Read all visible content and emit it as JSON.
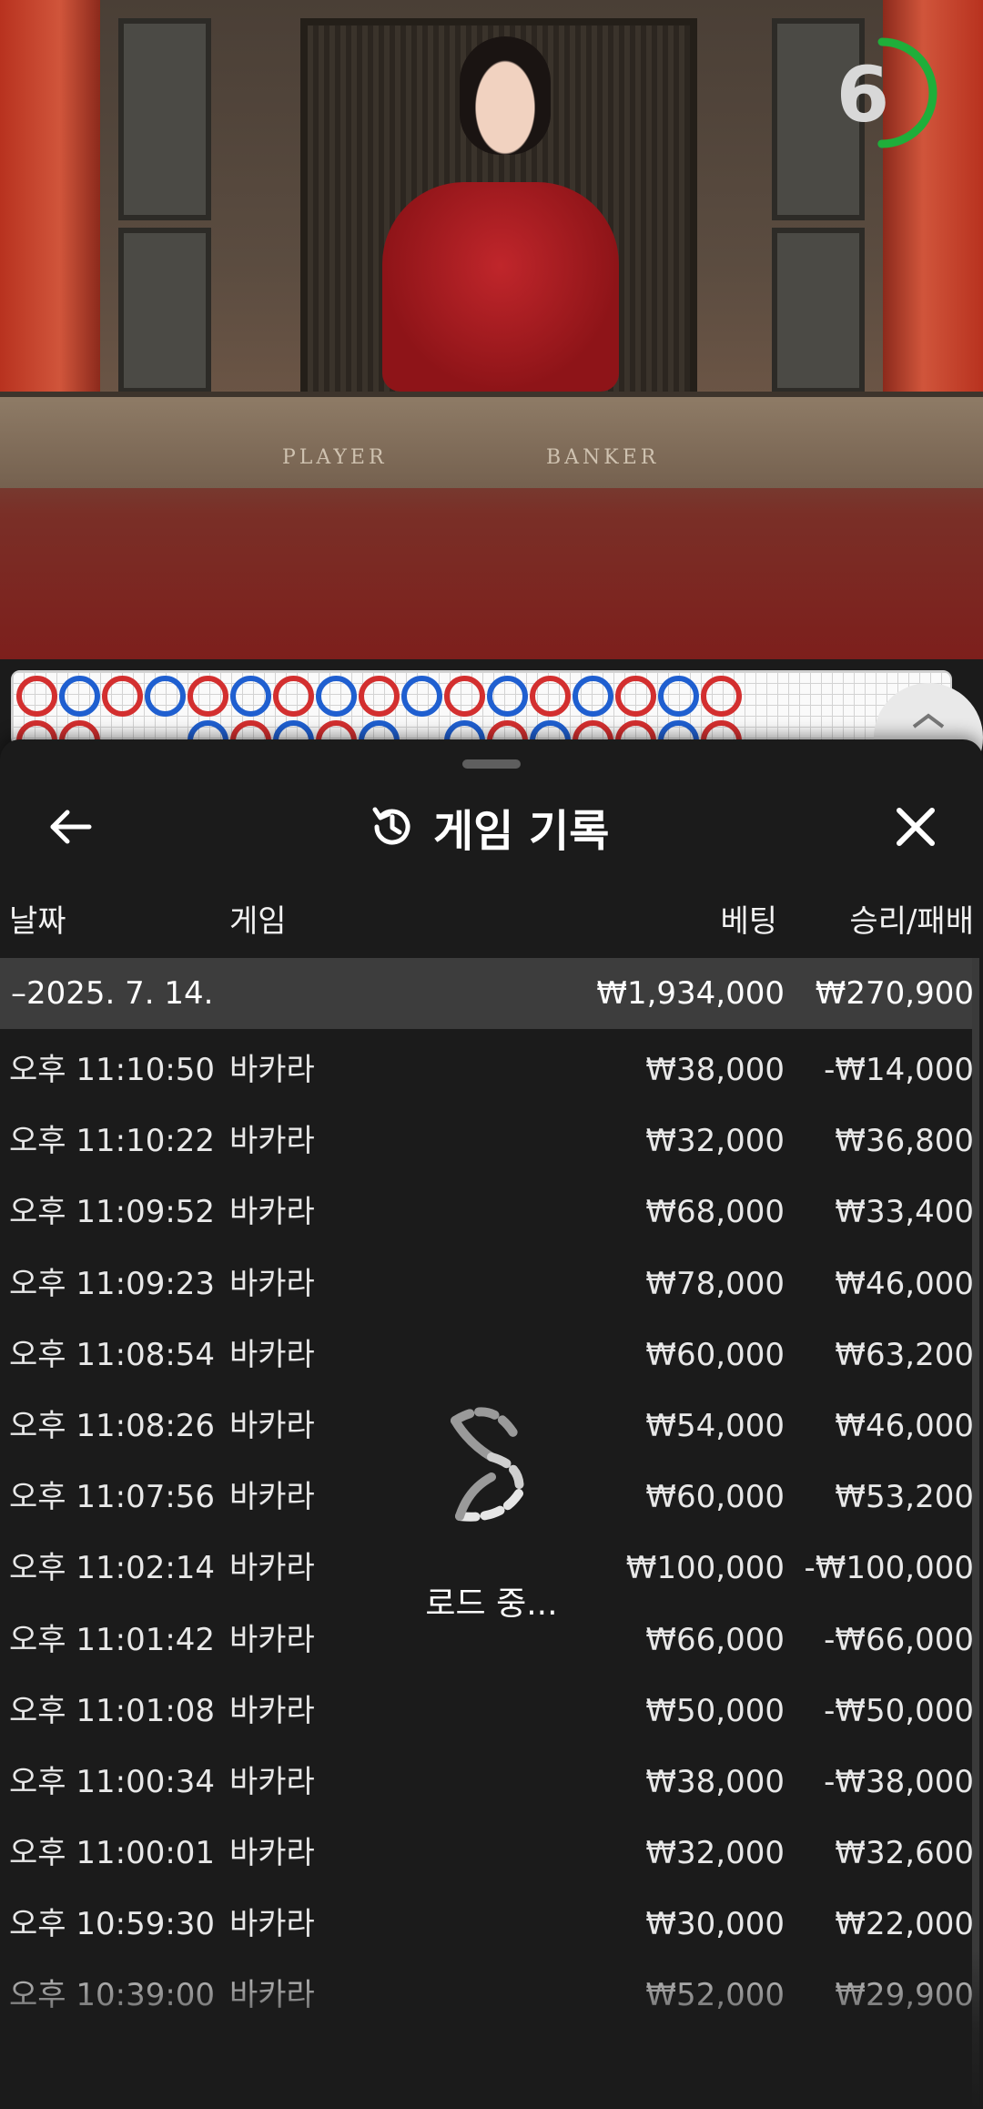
{
  "video": {
    "table_labels": [
      "PLAYER",
      "BANKER"
    ],
    "countdown": "6",
    "countdown_color": "#1fae3a"
  },
  "roadmap": {
    "player_color": "#1f5fd0",
    "banker_color": "#d32f2f",
    "row1": [
      "R",
      "B",
      "R",
      "B",
      "R",
      "B",
      "R",
      "B",
      "R",
      "B",
      "R",
      "B",
      "R",
      "B",
      "R",
      "B",
      "R"
    ],
    "row2": [
      "R",
      "R",
      "E",
      "E",
      "B",
      "R",
      "B",
      "R",
      "B",
      "E",
      "B",
      "R",
      "B",
      "R",
      "R",
      "B",
      "R"
    ]
  },
  "sheet": {
    "title": "게임 기록",
    "back_icon": "arrow-left-icon",
    "title_icon": "history-icon",
    "close_icon": "close-icon",
    "columns": {
      "date": "날짜",
      "game": "게임",
      "bet": "베팅",
      "result": "승리/패배"
    },
    "summary": {
      "date": "–2025. 7. 14.",
      "bet": "₩1,934,000",
      "result": "₩270,900"
    },
    "rows": [
      {
        "time": "오후 11:10:50",
        "game": "바카라",
        "bet": "₩38,000",
        "result": "-₩14,000"
      },
      {
        "time": "오후 11:10:22",
        "game": "바카라",
        "bet": "₩32,000",
        "result": "₩36,800"
      },
      {
        "time": "오후 11:09:52",
        "game": "바카라",
        "bet": "₩68,000",
        "result": "₩33,400"
      },
      {
        "time": "오후 11:09:23",
        "game": "바카라",
        "bet": "₩78,000",
        "result": "₩46,000"
      },
      {
        "time": "오후 11:08:54",
        "game": "바카라",
        "bet": "₩60,000",
        "result": "₩63,200"
      },
      {
        "time": "오후 11:08:26",
        "game": "바카라",
        "bet": "₩54,000",
        "result": "₩46,000"
      },
      {
        "time": "오후 11:07:56",
        "game": "바카라",
        "bet": "₩60,000",
        "result": "₩53,200"
      },
      {
        "time": "오후 11:02:14",
        "game": "바카라",
        "bet": "₩100,000",
        "result": "-₩100,000"
      },
      {
        "time": "오후 11:01:42",
        "game": "바카라",
        "bet": "₩66,000",
        "result": "-₩66,000"
      },
      {
        "time": "오후 11:01:08",
        "game": "바카라",
        "bet": "₩50,000",
        "result": "-₩50,000"
      },
      {
        "time": "오후 11:00:34",
        "game": "바카라",
        "bet": "₩38,000",
        "result": "-₩38,000"
      },
      {
        "time": "오후 11:00:01",
        "game": "바카라",
        "bet": "₩32,000",
        "result": "₩32,600"
      },
      {
        "time": "오후 10:59:30",
        "game": "바카라",
        "bet": "₩30,000",
        "result": "₩22,000"
      },
      {
        "time": "오후 10:39:00",
        "game": "바카라",
        "bet": "₩52,000",
        "result": "₩29,900"
      }
    ],
    "loading_text": "로드 중..."
  }
}
